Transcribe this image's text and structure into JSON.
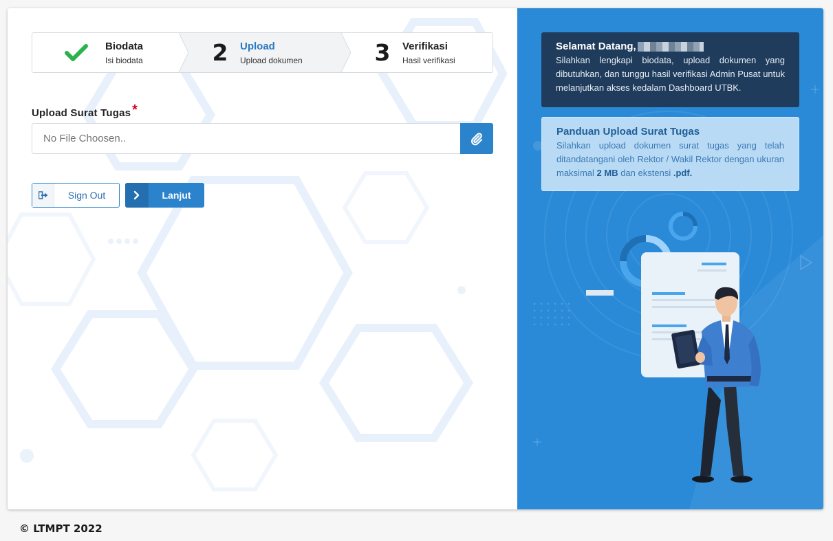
{
  "stepper": {
    "steps": [
      {
        "marker": "",
        "title": "Biodata",
        "subtitle": "Isi biodata",
        "state": "done"
      },
      {
        "marker": "2",
        "title": "Upload",
        "subtitle": "Upload dokumen",
        "state": "active"
      },
      {
        "marker": "3",
        "title": "Verifikasi",
        "subtitle": "Hasil verifikasi",
        "state": "pending"
      }
    ]
  },
  "upload": {
    "label": "Upload Surat Tugas",
    "required_mark": "*",
    "placeholder": "No File Choosen.."
  },
  "actions": {
    "signout_label": "Sign Out",
    "next_label": "Lanjut"
  },
  "welcome": {
    "title": "Selamat Datang,",
    "body": "Silahkan lengkapi biodata, upload dokumen yang dibutuhkan, dan tunggu hasil verifikasi Admin Pusat untuk melanjutkan akses kedalam Dashboard UTBK."
  },
  "guide": {
    "title": "Panduan Upload Surat Tugas",
    "body_before_size": "Silahkan upload dokumen surat tugas yang telah ditandatangani oleh Rektor / Wakil Rektor dengan ukuran maksimal",
    "size": "2 MB",
    "body_middle": "dan ekstensi",
    "ext": ".pdf."
  },
  "footer": {
    "copyright": "© LTMPT 2022"
  },
  "colors": {
    "primary": "#2b83cc",
    "panel_blue": "#2a8ad8",
    "welcome_box": "#1f3c5c",
    "check_green": "#2bb24c",
    "required_red": "#d0021b"
  }
}
